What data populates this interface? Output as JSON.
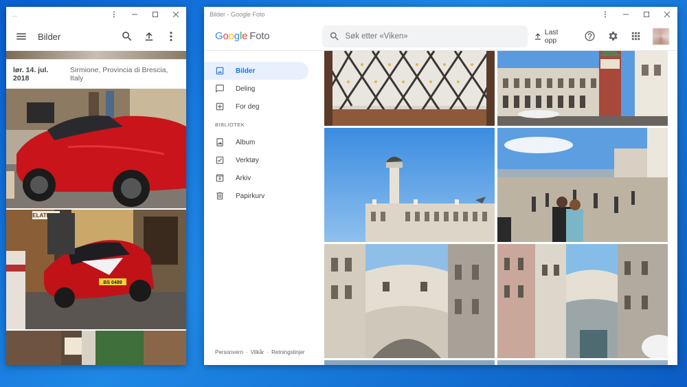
{
  "left_window": {
    "title": "...",
    "appbar_title": "Bilder",
    "date_header": {
      "date": "lør. 14. jul. 2018",
      "place": "Sirmione, Provincia di Brescia, Italy"
    },
    "plate_text": "BS 0489",
    "sign_text": "ELATERIA"
  },
  "right_window": {
    "title": "Bilder - Google Foto",
    "logo": {
      "google": "Google",
      "product": "Foto"
    },
    "search": {
      "placeholder": "Søk etter «Viken»",
      "value": ""
    },
    "upload_label": "Last opp",
    "nav": {
      "items": [
        {
          "label": "Bilder",
          "icon": "photo-icon",
          "active": true
        },
        {
          "label": "Deling",
          "icon": "chat-icon"
        },
        {
          "label": "For deg",
          "icon": "plus-box-icon"
        }
      ],
      "library_label": "BIBLIOTEK",
      "library_items": [
        {
          "label": "Album",
          "icon": "album-icon"
        },
        {
          "label": "Verktøy",
          "icon": "tools-icon"
        },
        {
          "label": "Arkiv",
          "icon": "archive-icon"
        },
        {
          "label": "Papirkurv",
          "icon": "trash-icon"
        }
      ]
    },
    "footer": {
      "privacy": "Personvern",
      "terms": "Vilkår",
      "policy": "Retningslinjer"
    }
  },
  "colors": {
    "accent": "#1a73e8",
    "active_bg": "#e8f0fe",
    "desktop": "#1e88e5"
  }
}
